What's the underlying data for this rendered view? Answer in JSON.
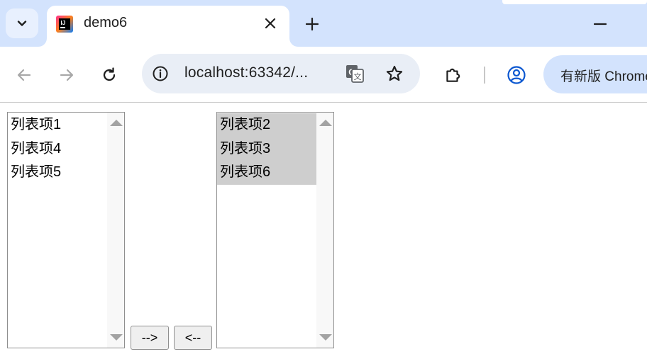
{
  "browser": {
    "tab_title": "demo6",
    "url": "localhost:63342/...",
    "update_button_label": "有新版 Chrome",
    "accent_color": "#0b57d0"
  },
  "icons": {
    "tab_search": "chevron-down-icon",
    "favicon": "intellij-icon",
    "close": "close-icon",
    "new_tab": "plus-icon",
    "minimize": "minimize-icon",
    "back": "arrow-left-icon",
    "forward": "arrow-right-icon",
    "reload": "reload-icon",
    "site_info": "info-icon",
    "translate": "translate-icon",
    "bookmark": "star-icon",
    "extensions": "puzzle-icon",
    "profile": "profile-icon"
  },
  "page": {
    "left_list": {
      "items": [
        {
          "label": "列表项1",
          "selected": false
        },
        {
          "label": "列表项4",
          "selected": false
        },
        {
          "label": "列表项5",
          "selected": false
        }
      ]
    },
    "right_list": {
      "items": [
        {
          "label": "列表项2",
          "selected": true
        },
        {
          "label": "列表项3",
          "selected": true
        },
        {
          "label": "列表项6",
          "selected": true
        }
      ]
    },
    "move_right_label": "-->",
    "move_left_label": "<--"
  }
}
